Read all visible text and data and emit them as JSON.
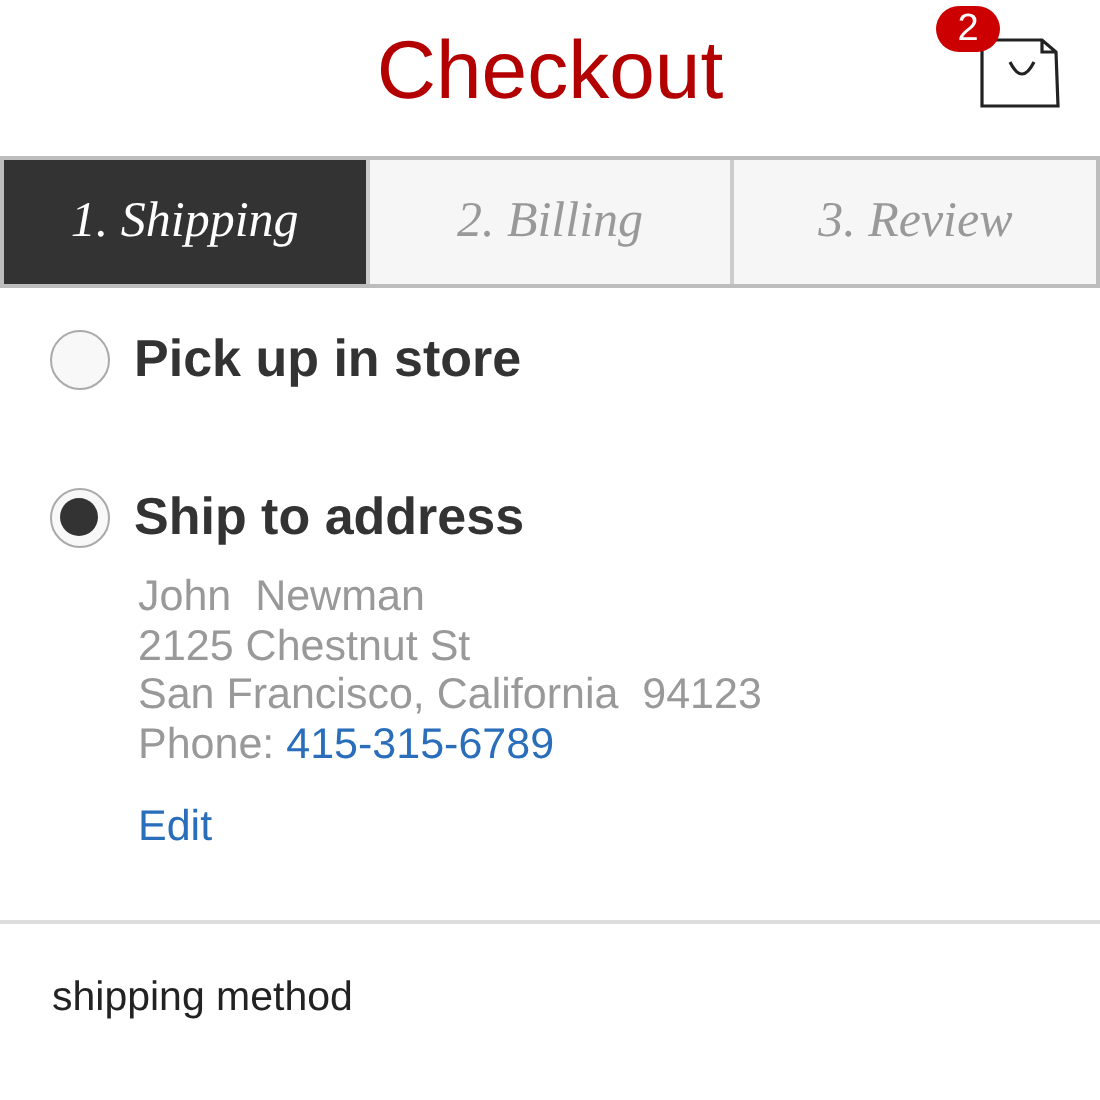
{
  "header": {
    "title": "Checkout",
    "cart_count": "2"
  },
  "tabs": [
    {
      "label": "1. Shipping",
      "selected": true
    },
    {
      "label": "2. Billing",
      "selected": false
    },
    {
      "label": "3. Review",
      "selected": false
    }
  ],
  "delivery_options": [
    {
      "label": "Pick up in store",
      "selected": false
    },
    {
      "label": "Ship to address",
      "selected": true
    }
  ],
  "address": {
    "lines": [
      "John  Newman",
      "2125 Chestnut St",
      "San Francisco, California  94123"
    ],
    "phone_label": "Phone:",
    "phone": "415-315-6789",
    "edit_link": "Edit"
  },
  "shipping_method": {
    "heading": "shipping method"
  }
}
